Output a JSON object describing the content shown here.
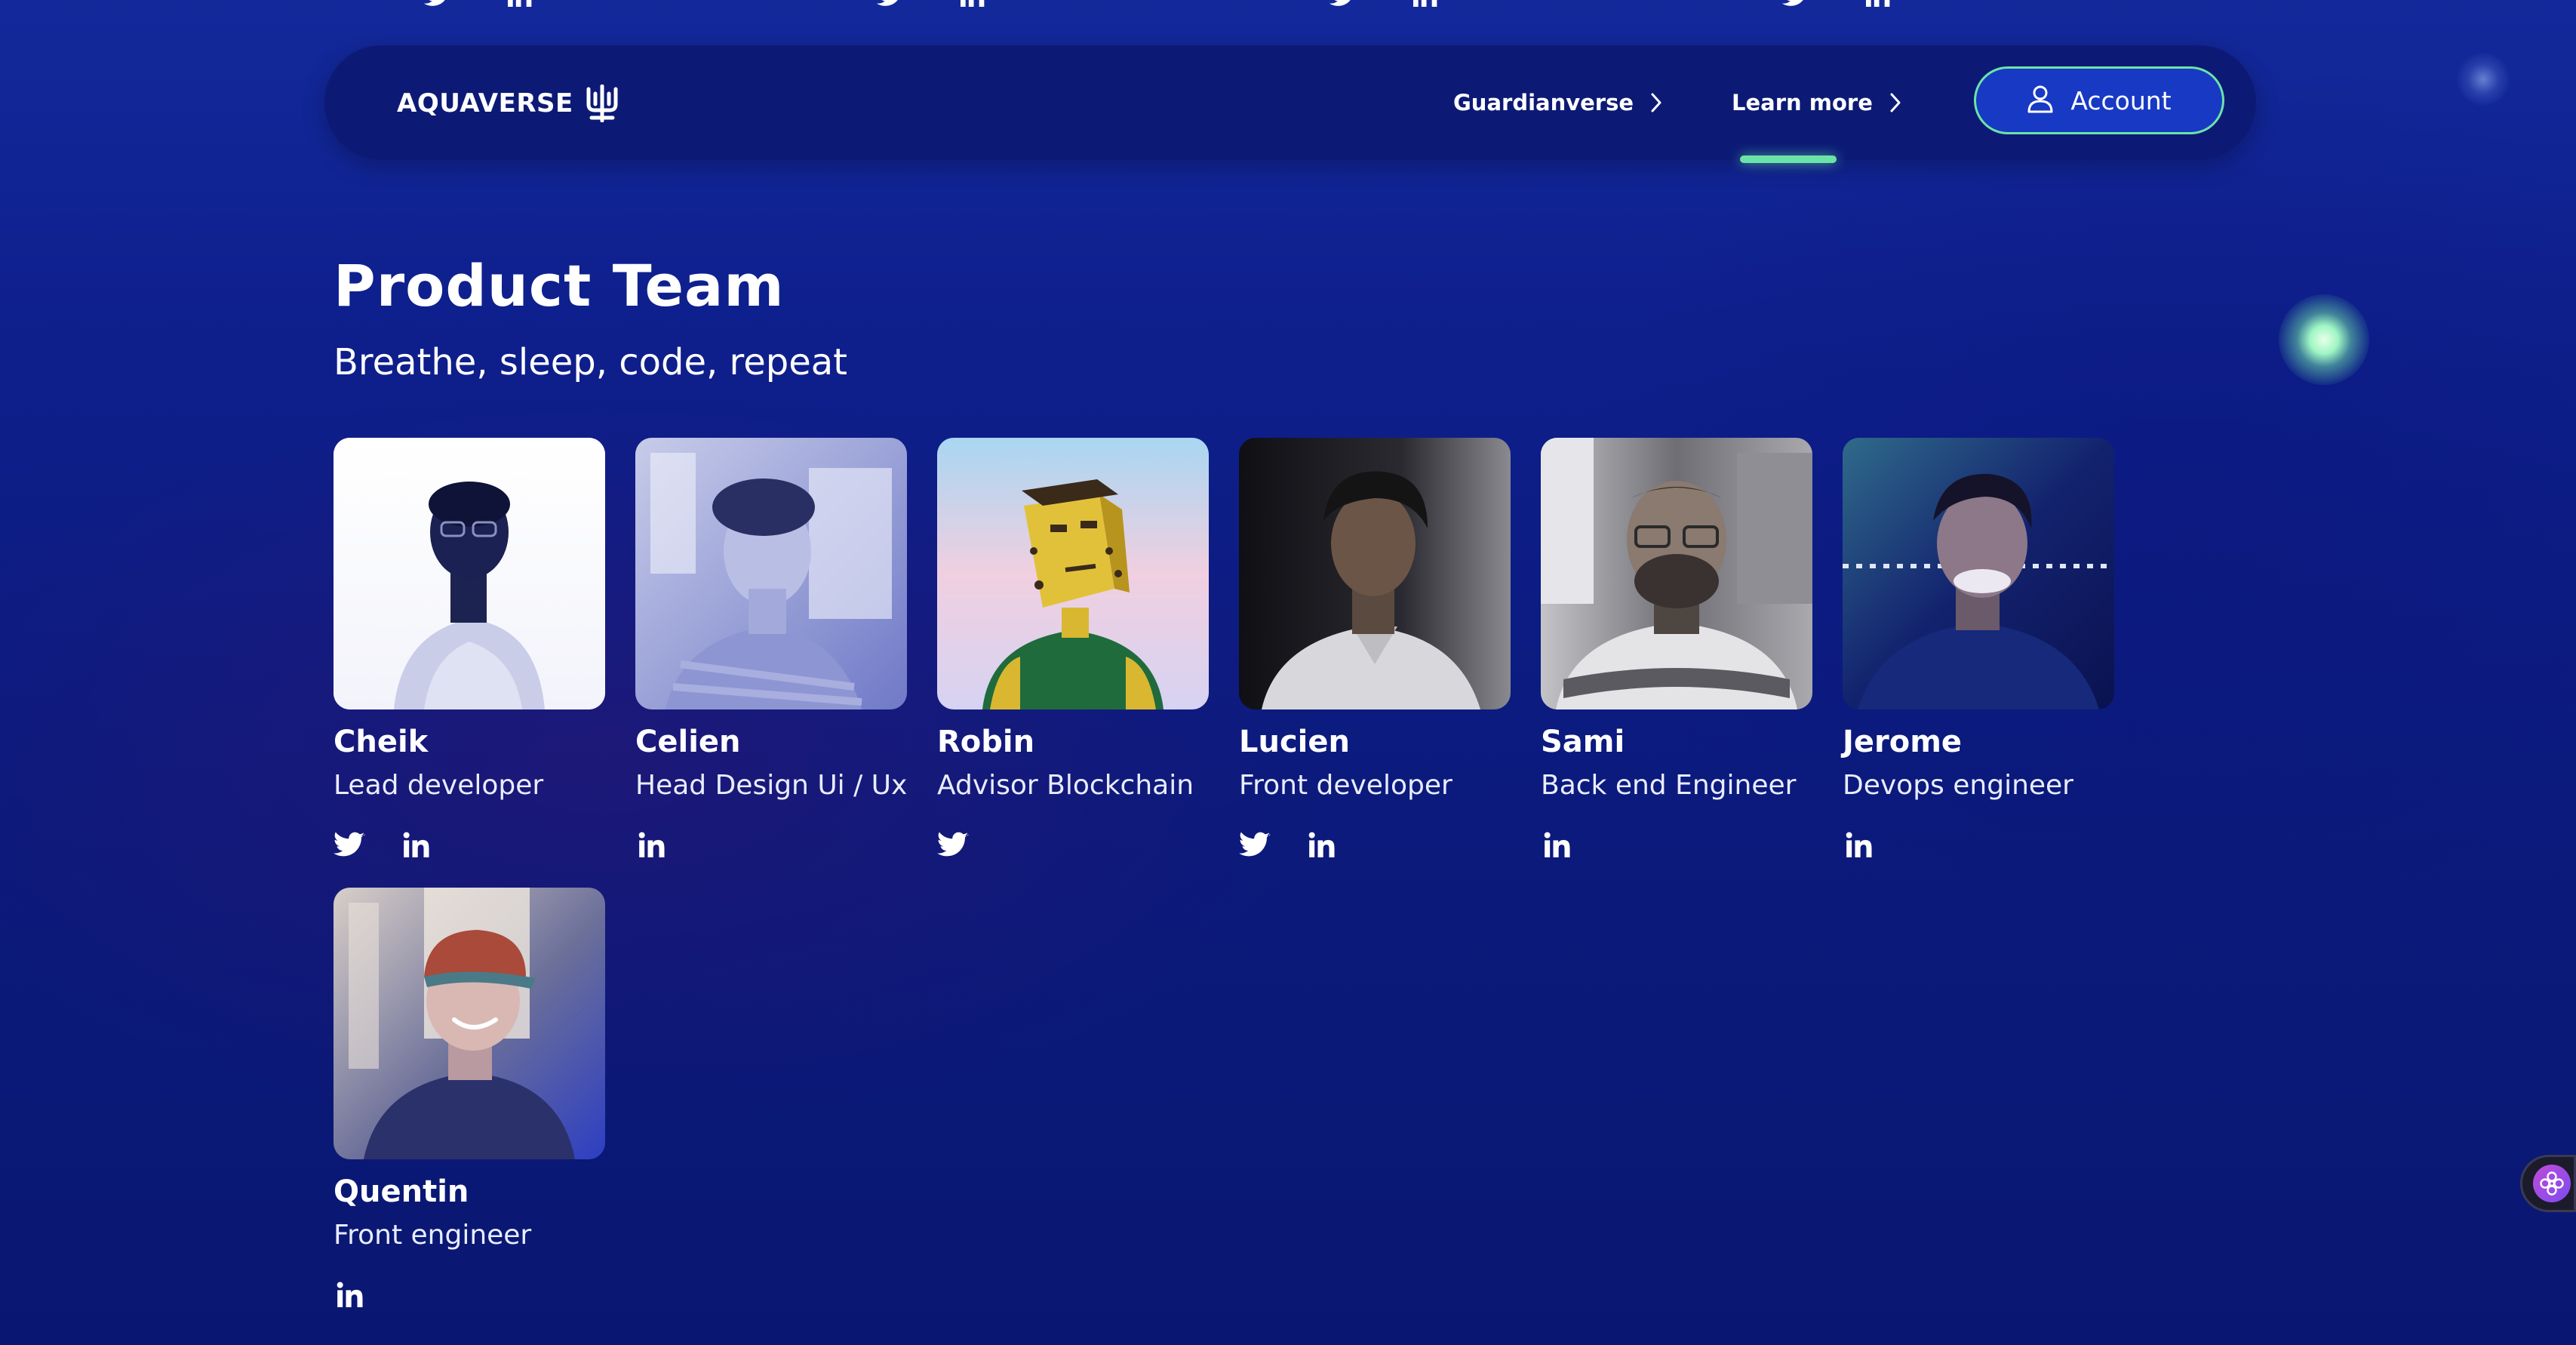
{
  "nav": {
    "logo_text": "AQUAVERSE",
    "links": [
      {
        "label": "Guardianverse",
        "active": false
      },
      {
        "label": "Learn more",
        "active": true
      }
    ],
    "account_label": "Account"
  },
  "section": {
    "title": "Product Team",
    "subtitle": "Breathe, sleep, code, repeat"
  },
  "members": [
    {
      "name": "Cheik",
      "role": "Lead developer",
      "social": [
        "twitter-icon",
        "linkedin-icon"
      ]
    },
    {
      "name": "Celien",
      "role": "Head Design Ui / Ux",
      "social": [
        "linkedin-icon"
      ]
    },
    {
      "name": "Robin",
      "role": "Advisor Blockchain",
      "social": [
        "twitter-icon"
      ]
    },
    {
      "name": "Lucien",
      "role": "Front developer",
      "social": [
        "twitter-icon",
        "linkedin-icon"
      ]
    },
    {
      "name": "Sami",
      "role": "Back end Engineer",
      "social": [
        "linkedin-icon"
      ]
    },
    {
      "name": "Jerome",
      "role": "Devops engineer",
      "social": [
        "linkedin-icon"
      ]
    },
    {
      "name": "Quentin",
      "role": "Front engineer",
      "social": [
        "linkedin-icon"
      ]
    }
  ],
  "colors": {
    "background": "#0b1a7c",
    "nav_background": "#0c1a76",
    "accent_green": "#6be3a7",
    "button_blue": "#1739c4"
  }
}
